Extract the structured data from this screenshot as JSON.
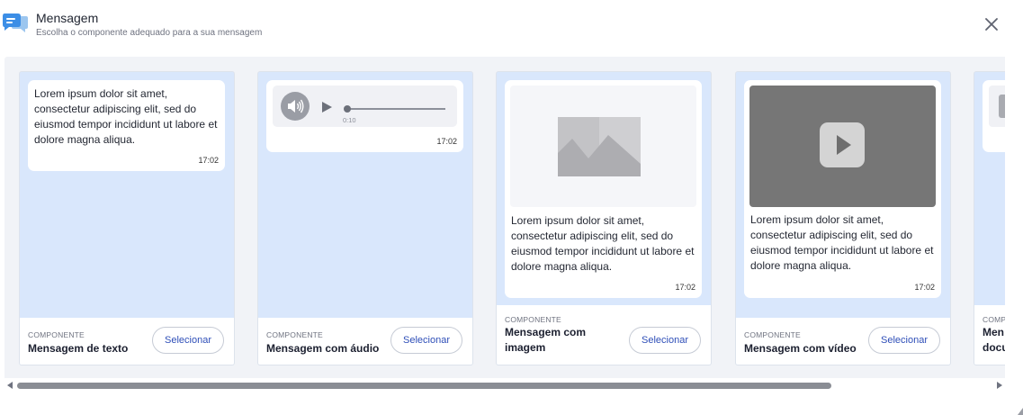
{
  "header": {
    "title": "Mensagem",
    "subtitle": "Escolha o componente adequado para a sua mensagem",
    "icon": "chat-bubbles-icon",
    "accent_color": "#3c8ee6"
  },
  "message": {
    "text": "Lorem ipsum dolor sit amet, consectetur adipiscing elit, sed do eiusmod tempor incididunt ut labore et dolore magna aliqua.",
    "time": "17:02"
  },
  "audio": {
    "duration": "0:10",
    "time": "17:02"
  },
  "cards": [
    {
      "label": "COMPONENTE",
      "name": "Mensagem de texto",
      "button": "Selecionar"
    },
    {
      "label": "COMPONENTE",
      "name": "Mensagem com áudio",
      "button": "Selecionar"
    },
    {
      "label": "COMPONENTE",
      "name_line1": "Mensagem com",
      "name_line2": "imagem",
      "button": "Selecionar"
    },
    {
      "label": "COMPONENTE",
      "name": "Mensagem com vídeo",
      "button": "Selecionar"
    },
    {
      "label": "COMP",
      "name_line1": "Men",
      "name_line2": "docu"
    }
  ],
  "colors": {
    "card_background": "#d9e7fc",
    "gallery_background": "#f1f3f7",
    "button_text": "#2f4fb8",
    "video_background": "#767676"
  }
}
